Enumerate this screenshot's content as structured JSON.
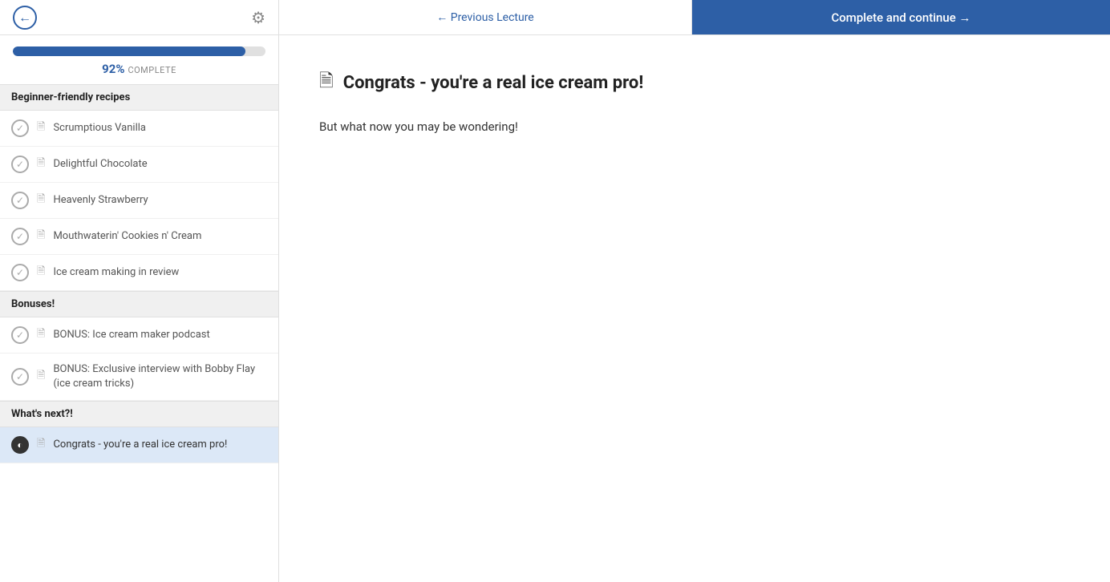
{
  "header": {
    "back_label": "←",
    "gear_label": "⚙",
    "prev_lecture": "← Previous Lecture",
    "complete_btn": "Complete and continue →"
  },
  "progress": {
    "percent": 92,
    "percent_label": "92%",
    "complete_word": "COMPLETE"
  },
  "sections": [
    {
      "id": "beginner",
      "title": "Beginner-friendly recipes",
      "lessons": [
        {
          "id": "vanilla",
          "title": "Scrumptious Vanilla",
          "checked": true,
          "active": false
        },
        {
          "id": "chocolate",
          "title": "Delightful Chocolate",
          "checked": true,
          "active": false
        },
        {
          "id": "strawberry",
          "title": "Heavenly Strawberry",
          "checked": true,
          "active": false
        },
        {
          "id": "cookies",
          "title": "Mouthwaterin' Cookies n' Cream",
          "checked": true,
          "active": false
        },
        {
          "id": "review",
          "title": "Ice cream making in review",
          "checked": true,
          "active": false
        }
      ]
    },
    {
      "id": "bonuses",
      "title": "Bonuses!",
      "lessons": [
        {
          "id": "podcast",
          "title": "BONUS: Ice cream maker podcast",
          "checked": true,
          "active": false
        },
        {
          "id": "interview",
          "title": "BONUS: Exclusive interview with Bobby Flay (ice cream tricks)",
          "checked": true,
          "active": false
        }
      ]
    },
    {
      "id": "whatsnext",
      "title": "What's next?!",
      "lessons": [
        {
          "id": "congrats",
          "title": "Congrats - you're a real ice cream pro!",
          "checked": false,
          "active": true
        }
      ]
    }
  ],
  "content": {
    "title": "Congrats - you're a real ice cream pro!",
    "body": "But what now you may be wondering!"
  }
}
